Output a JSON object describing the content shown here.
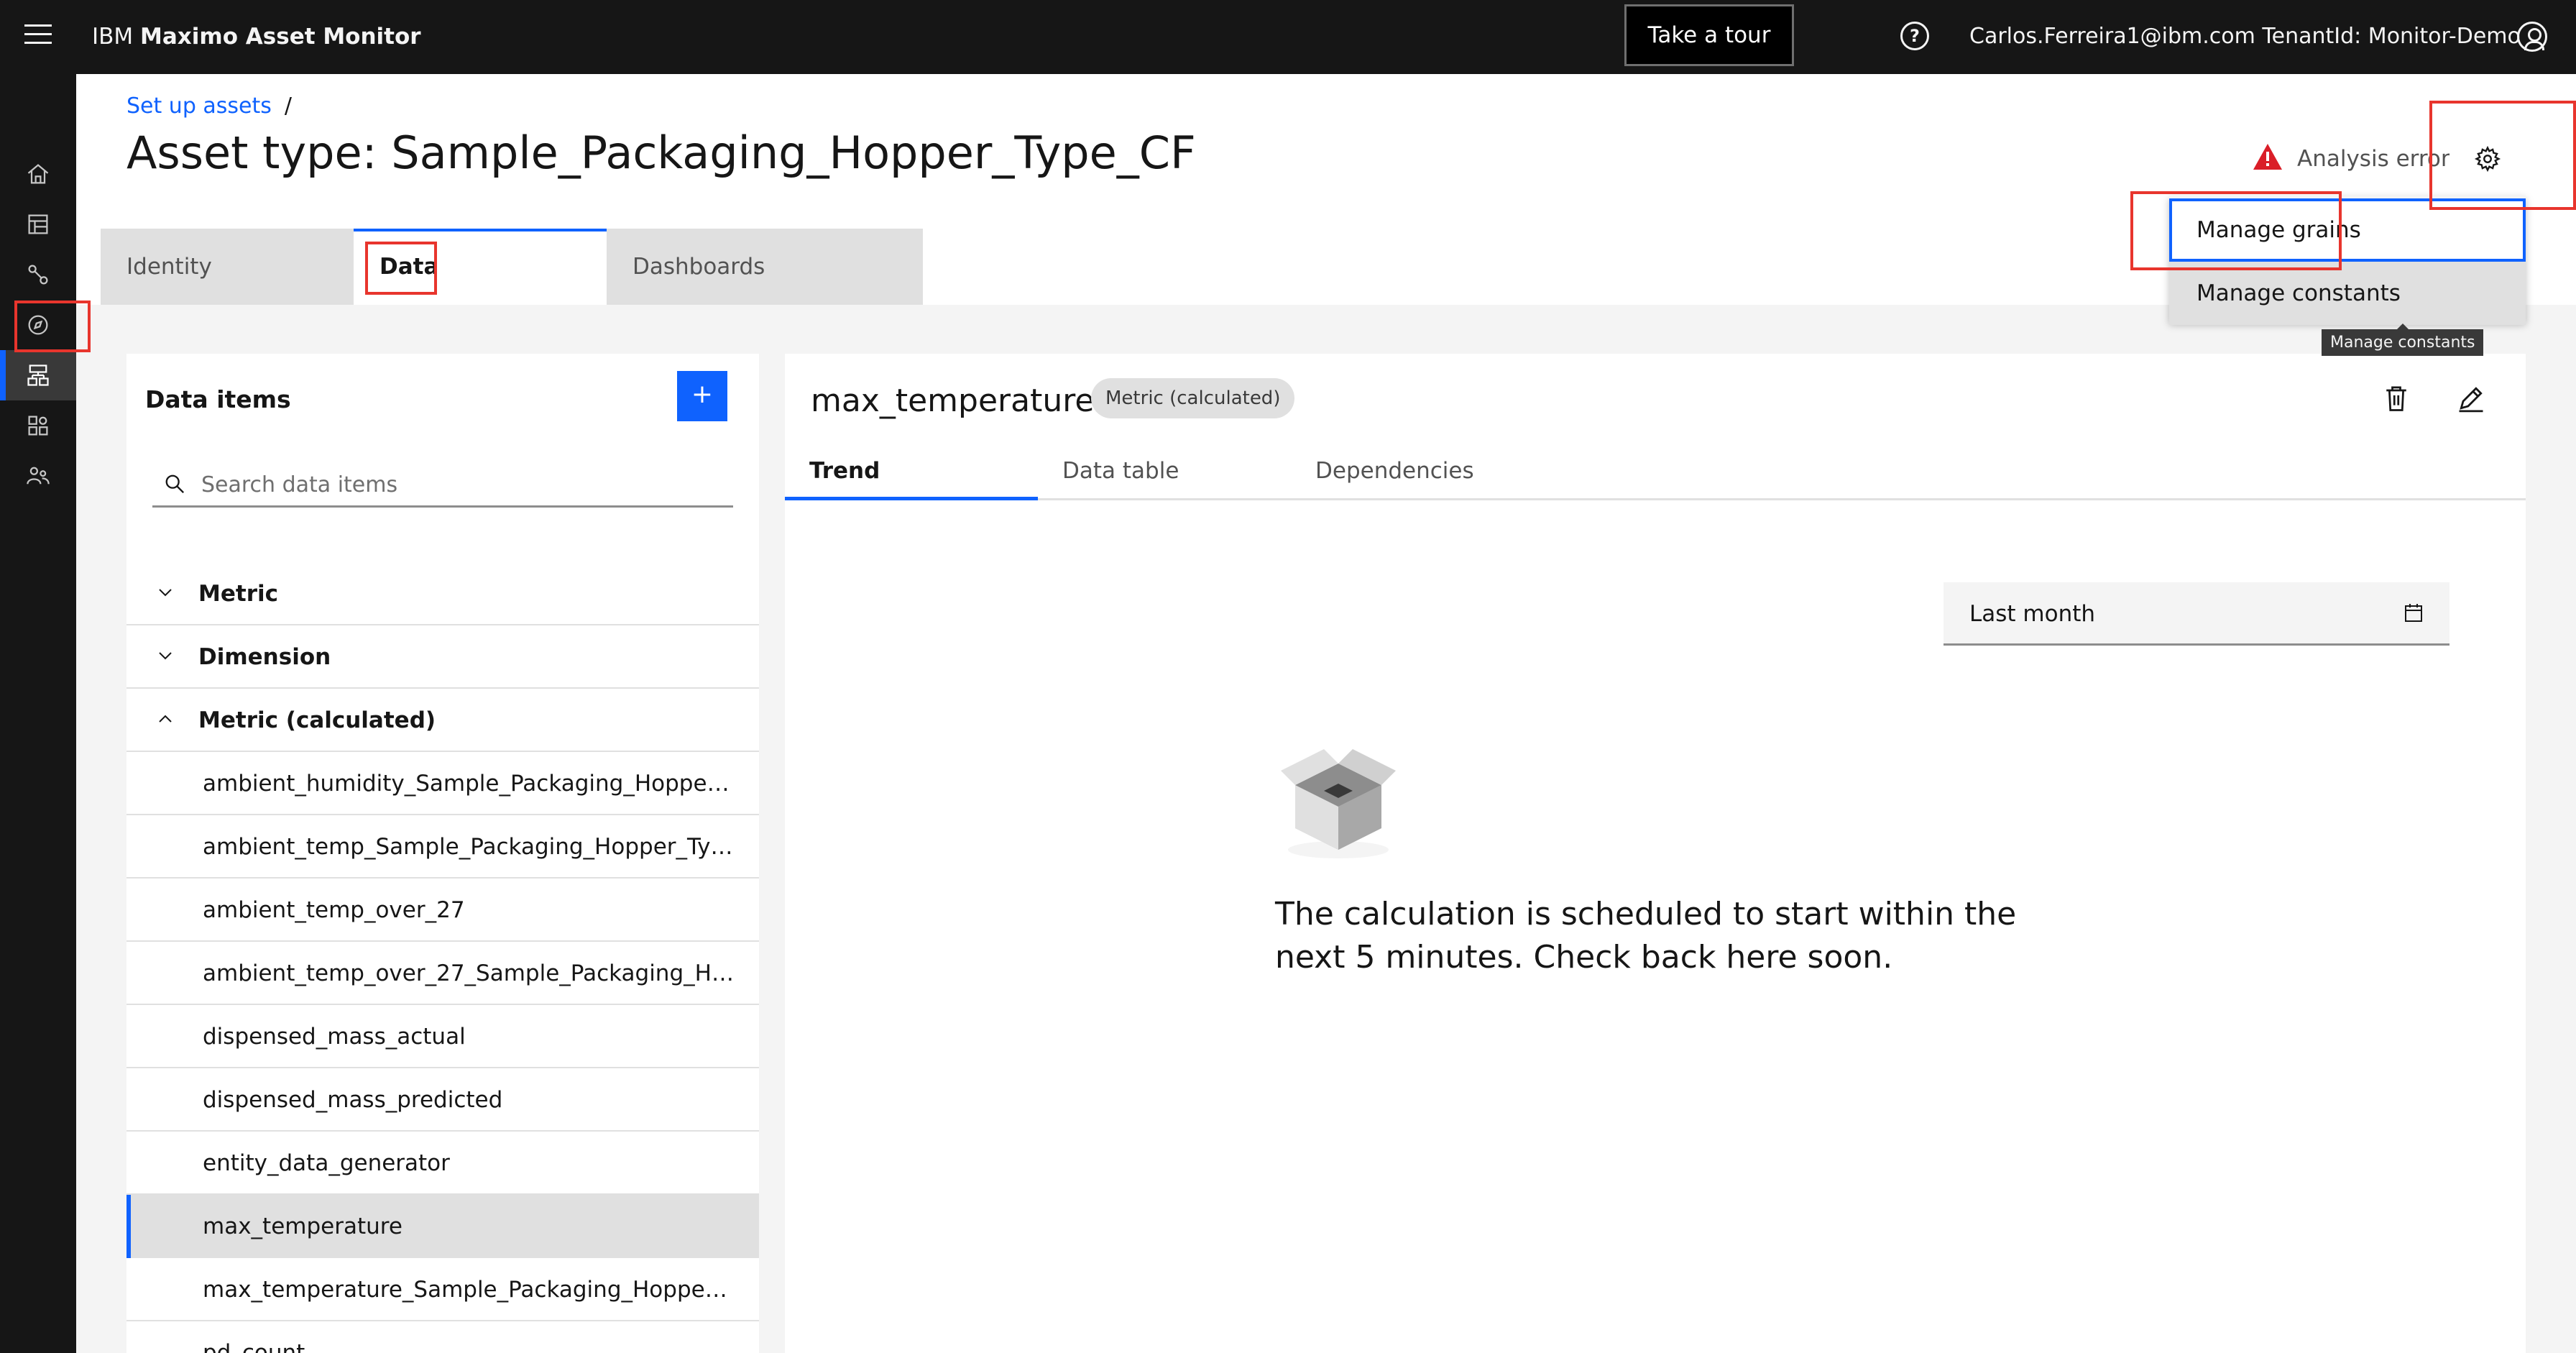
{
  "header": {
    "brand_prefix": "IBM",
    "brand_name": "Maximo Asset Monitor",
    "tour_button": "Take a tour",
    "user_info": "Carlos.Ferreira1@ibm.com TenantId: Monitor-Demo"
  },
  "rail": {
    "items": [
      "home-icon",
      "dashboard-icon",
      "connections-icon",
      "compass-icon",
      "setup-assets-icon",
      "app-grid-icon",
      "users-icon"
    ],
    "active_item": "setup-assets-icon"
  },
  "breadcrumb": {
    "link": "Set up assets",
    "separator": "/"
  },
  "page_title": "Asset type: Sample_Packaging_Hopper_Type_CF",
  "status": {
    "analysis_text": "Analysis error",
    "error_color": "#da1e28"
  },
  "settings_menu": {
    "items": [
      "Manage grains",
      "Manage constants"
    ],
    "tooltip": "Manage constants"
  },
  "tabs": [
    "Identity",
    "Data",
    "Dashboards"
  ],
  "active_tab": "Data",
  "data_panel": {
    "title": "Data items",
    "add_label": "+",
    "search_placeholder": "Search data items",
    "groups": [
      "Metric",
      "Dimension",
      "Metric (calculated)"
    ],
    "items": [
      "ambient_humidity_Sample_Packaging_Hopper_...",
      "ambient_temp_Sample_Packaging_Hopper_Typ...",
      "ambient_temp_over_27",
      "ambient_temp_over_27_Sample_Packaging_Ho...",
      "dispensed_mass_actual",
      "dispensed_mass_predicted",
      "entity_data_generator",
      "max_temperature",
      "max_temperature_Sample_Packaging_Hopper_...",
      "pd_count"
    ],
    "selected_item": "max_temperature"
  },
  "detail": {
    "title": "max_temperature",
    "tag": "Metric (calculated)",
    "tabs": [
      "Trend",
      "Data table",
      "Dependencies"
    ],
    "active_tab": "Trend",
    "date_range": "Last month",
    "empty_message": "The calculation is scheduled to start within the next 5 minutes. Check back here soon."
  },
  "colors": {
    "accent": "#0f62fe",
    "annotation": "#e8352d",
    "header_bg": "#161616"
  }
}
